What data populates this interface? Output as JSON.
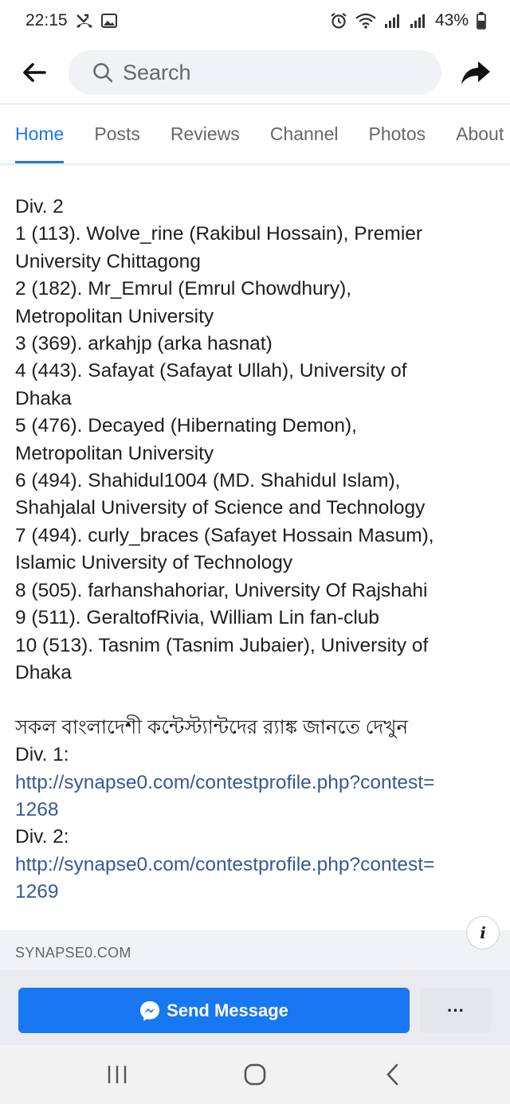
{
  "status_bar": {
    "time": "22:15",
    "battery": "43%"
  },
  "header": {
    "search_placeholder": "Search"
  },
  "tabs": [
    {
      "label": "Home",
      "active": true
    },
    {
      "label": "Posts",
      "active": false
    },
    {
      "label": "Reviews",
      "active": false
    },
    {
      "label": "Channel",
      "active": false
    },
    {
      "label": "Photos",
      "active": false
    },
    {
      "label": "About",
      "active": false
    }
  ],
  "post": {
    "div2_heading": "Div. 2",
    "ranks": [
      {
        "line1": "1 (113). Wolve_rine (Rakibul Hossain), Premier",
        "line2": "University Chittagong"
      },
      {
        "line1": "2 (182). Mr_Emrul (Emrul Chowdhury),",
        "line2": "Metropolitan University"
      },
      {
        "line1": "3 (369). arkahjp (arka hasnat)",
        "line2": ""
      },
      {
        "line1": "4 (443). Safayat (Safayat Ullah), University of",
        "line2": "Dhaka"
      },
      {
        "line1": "5 (476). Decayed (Hibernating Demon),",
        "line2": "Metropolitan University"
      },
      {
        "line1": "6 (494). Shahidul1004 (MD. Shahidul Islam),",
        "line2": "Shahjalal University of Science and Technology"
      },
      {
        "line1": "7 (494). curly_braces (Safayet Hossain Masum),",
        "line2": "Islamic University of Technology"
      },
      {
        "line1": "8 (505). farhanshahoriar, University Of Rajshahi",
        "line2": ""
      },
      {
        "line1": "9 (511). GeraltofRivia, William Lin fan-club",
        "line2": ""
      },
      {
        "line1": "10 (513). Tasnim (Tasnim Jubaier), University of",
        "line2": "Dhaka"
      }
    ],
    "bangla_line": "সকল বাংলাদেশী কন্টেস্ট্যান্টদের র‍্যাঙ্ক জানতে দেখুন",
    "div1_label": "Div. 1:",
    "div1_link_line1": "http://synapse0.com/contestprofile.php?contest=",
    "div1_link_line2": "1268",
    "div2_label": "Div. 2:",
    "div2_link_line1": "http://synapse0.com/contestprofile.php?contest=",
    "div2_link_line2": "1269"
  },
  "link_preview": {
    "domain": "SYNAPSE0.COM",
    "info_glyph": "i"
  },
  "actions": {
    "send_message_label": "Send Message",
    "more_label": "···"
  },
  "colors": {
    "accent": "#1877f2",
    "link": "#385898"
  }
}
